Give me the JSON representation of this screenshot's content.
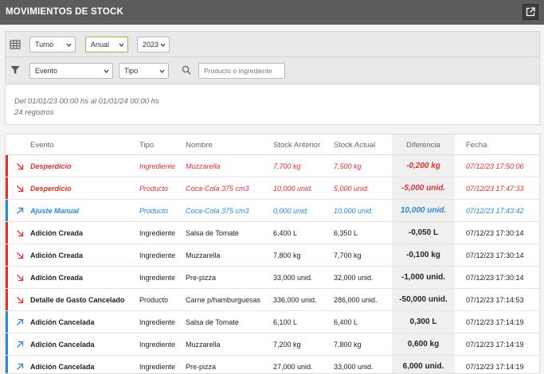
{
  "window": {
    "title": "MOVIMIENTOS DE STOCK"
  },
  "filters": {
    "periodo": "Turno",
    "rango": "Anual",
    "anio": "2023",
    "evento": "Evento",
    "tipo": "Tipo",
    "search_placeholder": "Producto o ingrediente"
  },
  "info": {
    "range": "Del 01/01/23 00:00 hs al 01/01/24 00:00 hs",
    "count": "24 registros"
  },
  "colors": {
    "negative": "#e03131",
    "positive": "#2f86d6",
    "neutral": "#222222"
  },
  "table": {
    "headers": [
      "Evento",
      "Tipo",
      "Nombre",
      "Stock Anterior",
      "Stock Actual",
      "Diferencia",
      "Fecha"
    ],
    "rows": [
      {
        "evento": "Desperdicio",
        "tipo": "Ingrediente",
        "nombre": "Muzzarella",
        "anterior": "7,700 kg",
        "actual": "7,500 kg",
        "diferencia": "-0,200 kg",
        "fecha": "07/12/23 17:50:06",
        "kind": "negative",
        "direction": "down"
      },
      {
        "evento": "Desperdicio",
        "tipo": "Producto",
        "nombre": "Coca-Cola 375 cm3",
        "anterior": "10,000 unid.",
        "actual": "5,000 unid.",
        "diferencia": "-5,000 unid.",
        "fecha": "07/12/23 17:47:33",
        "kind": "negative",
        "direction": "down"
      },
      {
        "evento": "Ajuste Manual",
        "tipo": "Producto",
        "nombre": "Coca-Cola 375 cm3",
        "anterior": "0,000 unid.",
        "actual": "10,000 unid.",
        "diferencia": "10,000 unid.",
        "fecha": "07/12/23 17:43:42",
        "kind": "positive",
        "direction": "up"
      },
      {
        "evento": "Adición Creada",
        "tipo": "Ingrediente",
        "nombre": "Salsa de Tomate",
        "anterior": "6,400 L",
        "actual": "6,350 L",
        "diferencia": "-0,050 L",
        "fecha": "07/12/23 17:30:14",
        "kind": "neutral",
        "direction": "down"
      },
      {
        "evento": "Adición Creada",
        "tipo": "Ingrediente",
        "nombre": "Muzzarella",
        "anterior": "7,800 kg",
        "actual": "7,700 kg",
        "diferencia": "-0,100 kg",
        "fecha": "07/12/23 17:30:14",
        "kind": "neutral",
        "direction": "down"
      },
      {
        "evento": "Adición Creada",
        "tipo": "Ingrediente",
        "nombre": "Pre-pizza",
        "anterior": "33,000 unid.",
        "actual": "32,000 unid.",
        "diferencia": "-1,000 unid.",
        "fecha": "07/12/23 17:30:14",
        "kind": "neutral",
        "direction": "down"
      },
      {
        "evento": "Detalle de Gasto Cancelado",
        "tipo": "Producto",
        "nombre": "Carne p/hamburguesas",
        "anterior": "336,000 unid.",
        "actual": "286,000 unid.",
        "diferencia": "-50,000 unid.",
        "fecha": "07/12/23 17:14:53",
        "kind": "neutral",
        "direction": "down"
      },
      {
        "evento": "Adición Cancelada",
        "tipo": "Ingrediente",
        "nombre": "Salsa de Tomate",
        "anterior": "6,100 L",
        "actual": "6,400 L",
        "diferencia": "0,300 L",
        "fecha": "07/12/23 17:14:19",
        "kind": "neutral",
        "direction": "up"
      },
      {
        "evento": "Adición Cancelada",
        "tipo": "Ingrediente",
        "nombre": "Muzzarella",
        "anterior": "7,200 kg",
        "actual": "7,800 kg",
        "diferencia": "0,600 kg",
        "fecha": "07/12/23 17:14:19",
        "kind": "neutral",
        "direction": "up"
      },
      {
        "evento": "Adición Cancelada",
        "tipo": "Ingrediente",
        "nombre": "Pre-pizza",
        "anterior": "27,000 unid.",
        "actual": "33,000 unid.",
        "diferencia": "6,000 unid.",
        "fecha": "07/12/23 17:14:19",
        "kind": "neutral",
        "direction": "up"
      }
    ]
  }
}
